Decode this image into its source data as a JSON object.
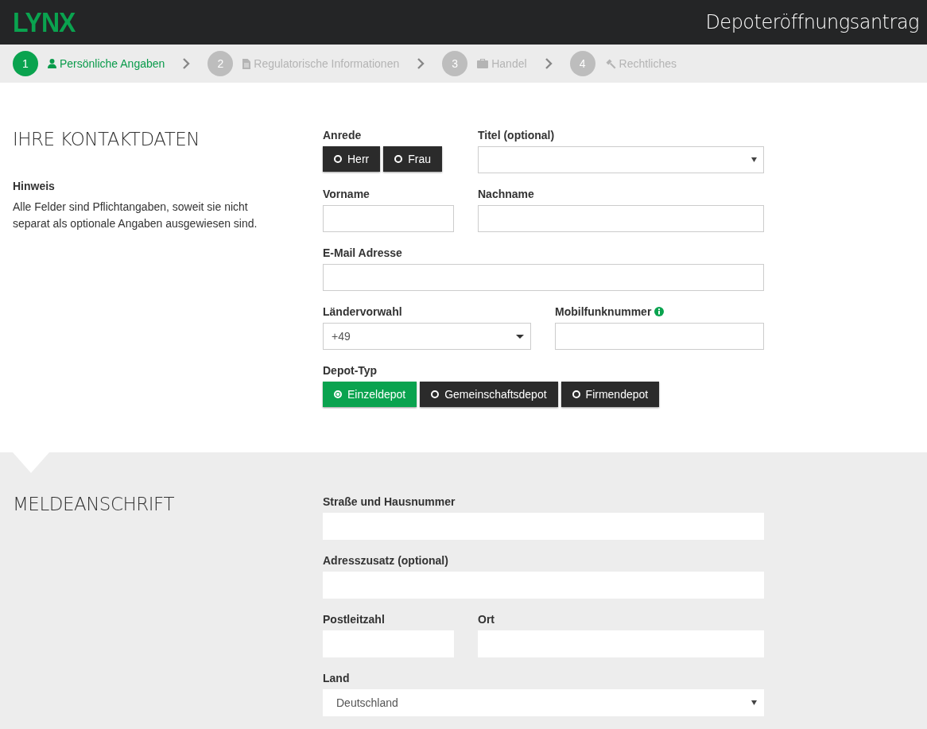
{
  "header": {
    "logo": "LYNX",
    "title": "Depoteröffnungsantrag"
  },
  "steps": [
    {
      "number": "1",
      "label": "Persönliche Angaben",
      "selected": true
    },
    {
      "number": "2",
      "label": "Regulatorische Informationen",
      "selected": false
    },
    {
      "number": "3",
      "label": "Handel",
      "selected": false
    },
    {
      "number": "4",
      "label": "Rechtliches",
      "selected": false
    }
  ],
  "sections": [
    {
      "title": "IHRE KONTAKTDATEN",
      "note_title": "Hinweis",
      "note": "Alle Felder sind Pflichtangaben, soweit sie nicht separat als optionale Angaben ausgewiesen sind.",
      "rows": [
        [
          {
            "kind": "radio",
            "label": "Anrede",
            "options": [
              {
                "label": "Herr",
                "selected": false
              },
              {
                "label": "Frau",
                "selected": false
              }
            ]
          },
          {
            "kind": "select",
            "label": "Titel (optional)"
          }
        ],
        [
          {
            "kind": "text",
            "label": "Vorname"
          },
          {
            "kind": "text",
            "label": "Nachname"
          }
        ],
        [
          {
            "kind": "text",
            "label": "E-Mail Adresse"
          }
        ],
        [
          {
            "kind": "dropdown",
            "label": "Ländervorwahl",
            "value": "+49"
          },
          {
            "kind": "text",
            "label": "Mobilfunknummer",
            "info": true
          }
        ],
        [
          {
            "kind": "radio",
            "label": "Depot-Typ",
            "options": [
              {
                "label": "Einzeldepot",
                "selected": true
              },
              {
                "label": "Gemeinschaftsdepot",
                "selected": false
              },
              {
                "label": "Firmendepot",
                "selected": false
              }
            ]
          }
        ]
      ]
    },
    {
      "title": "MELDEANSCHRIFT",
      "rows": [
        [
          {
            "kind": "text",
            "label": "Straße und Hausnummer"
          }
        ],
        [
          {
            "kind": "text",
            "label": "Adresszusatz (optional)"
          }
        ],
        [
          {
            "kind": "text",
            "label": "Postleitzahl"
          },
          {
            "kind": "text",
            "label": "Ort"
          }
        ],
        [
          {
            "kind": "select",
            "label": "Land",
            "value": "Deutschland"
          }
        ]
      ]
    }
  ]
}
